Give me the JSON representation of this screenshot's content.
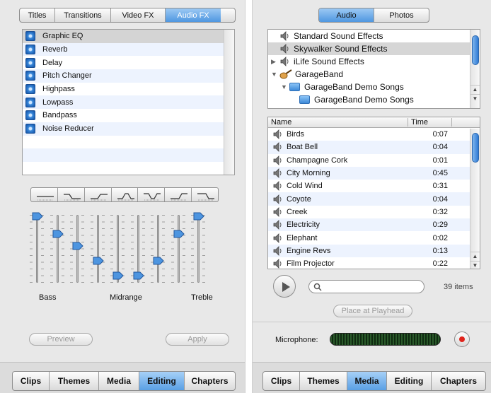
{
  "fx_tabs": [
    "Titles",
    "Transitions",
    "Video FX",
    "Audio FX"
  ],
  "fx_active": "Audio FX",
  "audio_effects": [
    "Graphic EQ",
    "Reverb",
    "Delay",
    "Pitch Changer",
    "Highpass",
    "Lowpass",
    "Bandpass",
    "Noise Reducer"
  ],
  "selected_effect": "Graphic EQ",
  "eq_labels": {
    "bass": "Bass",
    "midrange": "Midrange",
    "treble": "Treble"
  },
  "eq_levels": [
    1.0,
    0.72,
    0.52,
    0.28,
    0.05,
    0.05,
    0.28,
    0.72,
    1.0
  ],
  "left_buttons": {
    "preview": "Preview",
    "apply": "Apply"
  },
  "left_bottom_tabs": [
    "Clips",
    "Themes",
    "Media",
    "Editing",
    "Chapters"
  ],
  "left_bottom_active": "Editing",
  "media_tabs": [
    "Audio",
    "Photos"
  ],
  "media_active": "Audio",
  "library": [
    {
      "label": "Standard Sound Effects",
      "type": "speaker",
      "indent": 0
    },
    {
      "label": "Skywalker Sound Effects",
      "type": "speaker",
      "indent": 0,
      "selected": true
    },
    {
      "label": "iLife Sound Effects",
      "type": "speaker",
      "indent": 0,
      "disclosure": "right"
    },
    {
      "label": "GarageBand",
      "type": "guitar",
      "indent": 0,
      "disclosure": "down"
    },
    {
      "label": "GarageBand Demo Songs",
      "type": "folder",
      "indent": 1,
      "disclosure": "down"
    },
    {
      "label": "GarageBand Demo Songs",
      "type": "folder",
      "indent": 2
    }
  ],
  "table_headers": {
    "name": "Name",
    "time": "Time"
  },
  "sounds": [
    {
      "name": "Birds",
      "time": "0:07"
    },
    {
      "name": "Boat Bell",
      "time": "0:04"
    },
    {
      "name": "Champagne Cork",
      "time": "0:01"
    },
    {
      "name": "City Morning",
      "time": "0:45"
    },
    {
      "name": "Cold Wind",
      "time": "0:31"
    },
    {
      "name": "Coyote",
      "time": "0:04"
    },
    {
      "name": "Creek",
      "time": "0:32"
    },
    {
      "name": "Electricity",
      "time": "0:29"
    },
    {
      "name": "Elephant",
      "time": "0:02"
    },
    {
      "name": "Engine Revs",
      "time": "0:13"
    },
    {
      "name": "Film Projector",
      "time": "0:22"
    }
  ],
  "item_count": "39 items",
  "place_at_playhead": "Place at Playhead",
  "microphone_label": "Microphone:",
  "right_bottom_tabs": [
    "Clips",
    "Themes",
    "Media",
    "Editing",
    "Chapters"
  ],
  "right_bottom_active": "Media",
  "colors": {
    "accent": "#4f97e1",
    "record": "#e0241c",
    "meter": "#2b5a2b"
  }
}
